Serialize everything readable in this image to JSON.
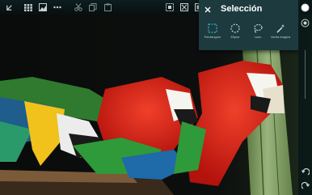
{
  "panel": {
    "title": "Selección",
    "tools": [
      {
        "name": "rectangle-select-icon",
        "label": "Rectángulo"
      },
      {
        "name": "ellipse-select-icon",
        "label": "Elipse"
      },
      {
        "name": "lasso-select-icon",
        "label": "Lazo"
      },
      {
        "name": "magic-wand-icon",
        "label": "Varita mágica"
      }
    ]
  },
  "toolbar": {
    "icons": [
      "back-icon",
      "grid-icon",
      "image-icon",
      "more-icon",
      "cut-icon",
      "copy-icon",
      "paste-icon",
      "crop-icon",
      "transform-icon",
      "layers-icon"
    ]
  },
  "sidebar": {
    "icons": [
      "color-circle-icon",
      "brush-size-icon",
      "undo-icon",
      "redo-icon"
    ]
  },
  "colors": {
    "panel_bg": "#1d3b3e",
    "accent": "#3fa9c9",
    "toolbar_bg": "#0c1a1c"
  }
}
